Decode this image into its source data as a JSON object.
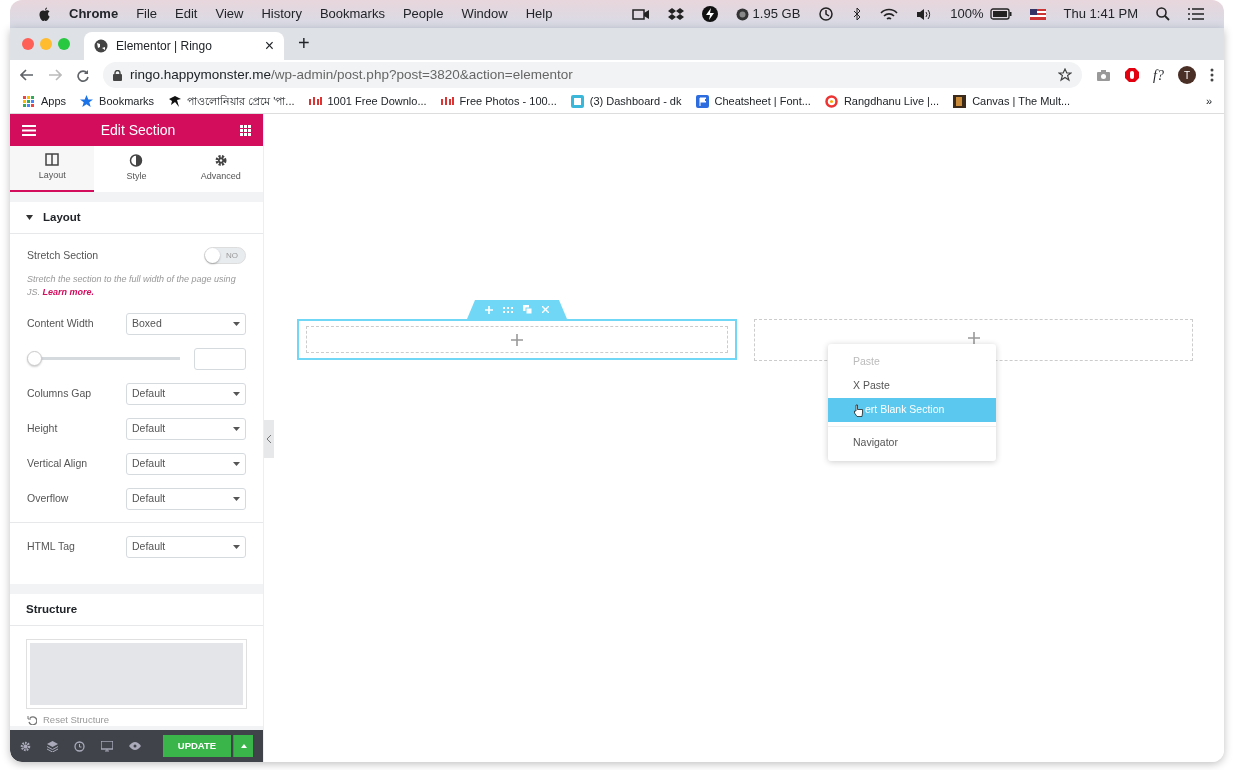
{
  "menubar": {
    "app": "Chrome",
    "items": [
      "File",
      "Edit",
      "View",
      "History",
      "Bookmarks",
      "People",
      "Window",
      "Help"
    ],
    "memory": "1.95 GB",
    "battery": "100%",
    "clock": "Thu 1:41 PM"
  },
  "browser": {
    "tab_title": "Elementor | Ringo",
    "tab_close": "×",
    "new_tab": "+",
    "url_host": "ringo.happymonster.me",
    "url_path": "/wp-admin/post.php?post=3820&action=elementor",
    "avatar": "T",
    "ext_text": "f?",
    "bookmarks": [
      {
        "label": "Apps",
        "kind": "apps"
      },
      {
        "label": "Bookmarks",
        "kind": "star"
      },
      {
        "label": "পাওলোনিয়ার প্রেমে 'পা...",
        "kind": "bird"
      },
      {
        "label": "1001 Free Downlo...",
        "kind": "bars"
      },
      {
        "label": "Free Photos - 100...",
        "kind": "bars"
      },
      {
        "label": "(3) Dashboard - dk",
        "kind": "square"
      },
      {
        "label": "Cheatsheet | Font...",
        "kind": "flag"
      },
      {
        "label": "Rangdhanu Live |...",
        "kind": "ring"
      },
      {
        "label": "Canvas | The Mult...",
        "kind": "photo"
      }
    ],
    "more": "»"
  },
  "panel": {
    "title": "Edit Section",
    "tabs": [
      {
        "label": "Layout",
        "kind": "columns",
        "selected": true
      },
      {
        "label": "Style",
        "kind": "contrast",
        "selected": false
      },
      {
        "label": "Advanced",
        "kind": "gear",
        "selected": false
      }
    ],
    "section_title": "Layout",
    "expanded": true,
    "stretch": {
      "label": "Stretch Section",
      "on": false,
      "toggle_text": "NO"
    },
    "help": "Stretch the section to the full width of the page using JS.",
    "help_link": "Learn more.",
    "fields": [
      {
        "label": "Content Width",
        "value": "Boxed",
        "kind": "select"
      },
      {
        "kind": "slider",
        "level": 0
      },
      {
        "label": "Columns Gap",
        "value": "Default",
        "kind": "select"
      },
      {
        "label": "Height",
        "value": "Default",
        "kind": "select"
      },
      {
        "label": "Vertical Align",
        "value": "Default",
        "kind": "select"
      },
      {
        "label": "Overflow",
        "value": "Default",
        "kind": "select"
      },
      {
        "label": "HTML Tag",
        "value": "Default",
        "kind": "select",
        "separated": true
      }
    ],
    "structure_title": "Structure",
    "reset": "Reset Structure",
    "update": "UPDATE"
  },
  "canvas": {
    "menu": [
      {
        "label": "Paste",
        "disabled": true,
        "selected": false
      },
      {
        "label": "X Paste",
        "disabled": false,
        "selected": false
      },
      {
        "label": "ert Blank Section",
        "disabled": false,
        "selected": true
      },
      {
        "label": "Navigator",
        "disabled": false,
        "selected": false,
        "separated": true
      }
    ]
  }
}
